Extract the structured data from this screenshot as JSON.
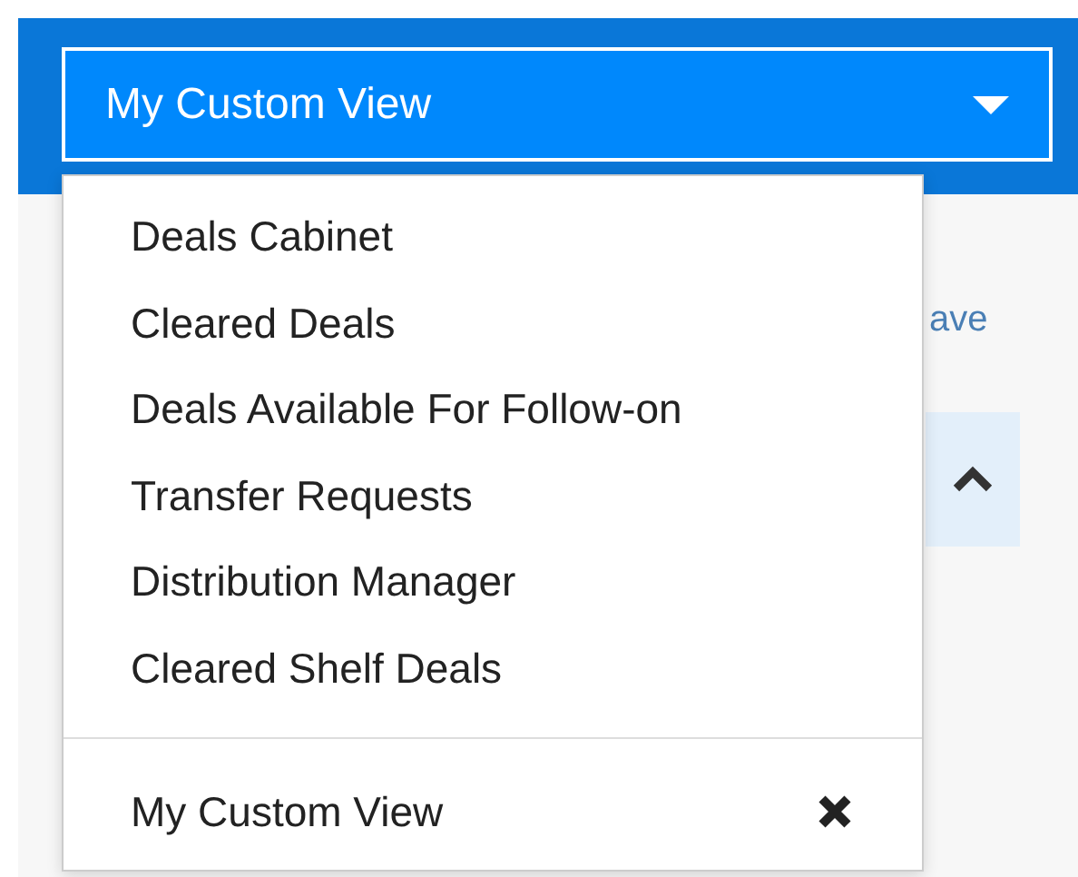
{
  "view_select": {
    "value": "My Custom View",
    "expanded": true
  },
  "menu": {
    "items": [
      {
        "label": "Deals Cabinet",
        "kind": "view"
      },
      {
        "label": "Cleared Deals",
        "kind": "view"
      },
      {
        "label": "Deals Available For Follow-on",
        "kind": "view"
      },
      {
        "label": "Transfer Requests",
        "kind": "view"
      },
      {
        "label": "Distribution Manager",
        "kind": "view"
      },
      {
        "label": "Cleared Shelf Deals",
        "kind": "view"
      },
      {
        "label": "My Custom View",
        "kind": "custom"
      }
    ]
  },
  "background": {
    "link": "ave",
    "section_toggle": {
      "expanded": true
    }
  }
}
